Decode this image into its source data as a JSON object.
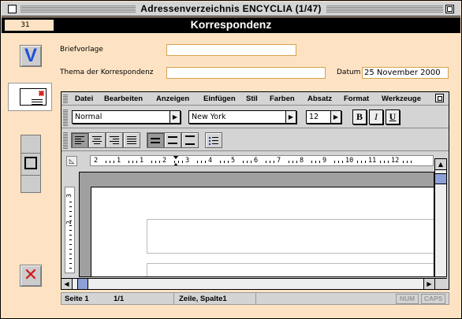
{
  "window": {
    "title": "Adressenverzeichnis ENCYCLIA (1/47)"
  },
  "header": {
    "record_number": "31",
    "section_title": "Korrespondenz"
  },
  "form": {
    "briefvorlage_label": "Briefvorlage",
    "briefvorlage_value": "",
    "thema_label": "Thema der Korrespondenz",
    "thema_value": "",
    "datum_label": "Datum",
    "datum_value": "25 November 2000"
  },
  "editor": {
    "menus": [
      "Datei",
      "Bearbeiten",
      "Anzeigen",
      "Einfügen",
      "Stil",
      "Farben",
      "Absatz",
      "Format",
      "Werkzeuge"
    ],
    "style_select": "Normal",
    "font_select": "New York",
    "size_select": "12",
    "bold_label": "B",
    "italic_label": "I",
    "underline_label": "U",
    "ruler_numbers": [
      "2",
      "1",
      "1",
      "2",
      "3",
      "4",
      "5",
      "6",
      "7",
      "8",
      "9",
      "10",
      "11",
      "12"
    ],
    "vruler_numbers": [
      "3",
      "2"
    ]
  },
  "status": {
    "page_label": "Seite 1",
    "page_count": "1/1",
    "position": "Zeile, Spalte1",
    "num": "NUM",
    "caps": "CAPS"
  },
  "colors": {
    "background": "#fde3c4",
    "field_border": "#d6a24f",
    "confirm": "#1e4fd8",
    "cancel": "#d01818"
  }
}
